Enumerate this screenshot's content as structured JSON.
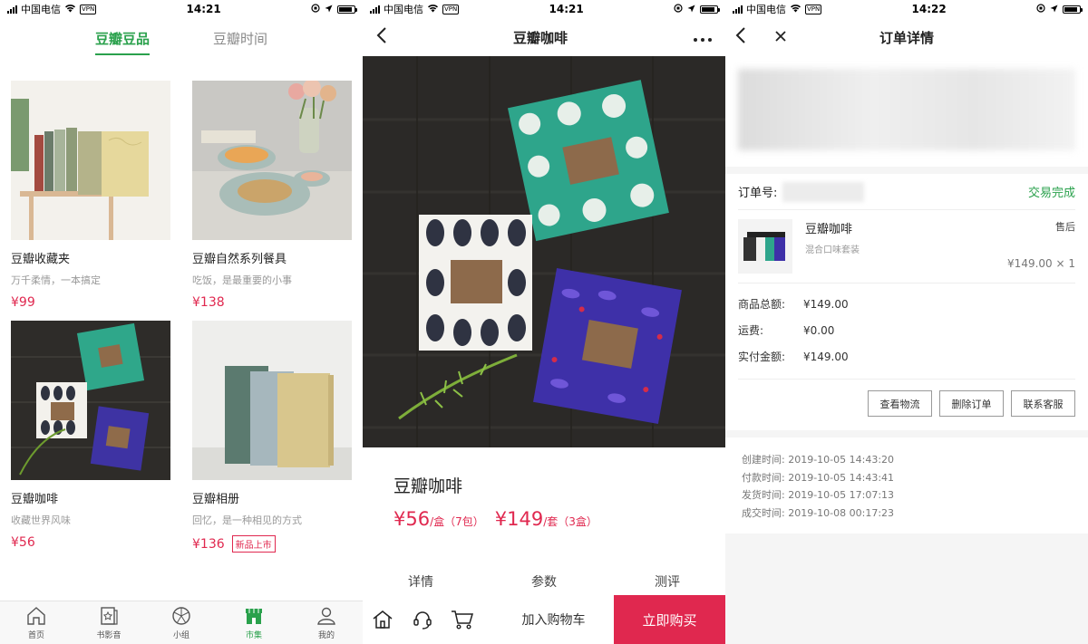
{
  "statusbar": [
    {
      "carrier": "中国电信",
      "vpn": "VPN",
      "time": "14:21"
    },
    {
      "carrier": "中国电信",
      "vpn": "VPN",
      "time": "14:21"
    },
    {
      "carrier": "中国电信",
      "vpn": "VPN",
      "time": "14:22"
    }
  ],
  "store": {
    "tabs": [
      "豆瓣豆品",
      "豆瓣时间"
    ],
    "products": [
      {
        "name": "豆瓣收藏夹",
        "desc": "万千柔情，一本搞定",
        "price": "¥99",
        "tag": ""
      },
      {
        "name": "豆瓣自然系列餐具",
        "desc": "吃饭，是最重要的小事",
        "price": "¥138",
        "tag": ""
      },
      {
        "name": "豆瓣咖啡",
        "desc": "收藏世界风味",
        "price": "¥56",
        "tag": ""
      },
      {
        "name": "豆瓣相册",
        "desc": "回忆，是一种相见的方式",
        "price": "¥136",
        "tag": "新品上市"
      }
    ],
    "tabbar": [
      {
        "label": "首页",
        "icon": "home-icon"
      },
      {
        "label": "书影音",
        "icon": "star-book-icon"
      },
      {
        "label": "小组",
        "icon": "group-icon"
      },
      {
        "label": "市集",
        "icon": "market-icon"
      },
      {
        "label": "我的",
        "icon": "profile-icon"
      }
    ]
  },
  "detail": {
    "title": "豆瓣咖啡",
    "product_title": "豆瓣咖啡",
    "price1": "¥56",
    "unit1": "/盒（7包）",
    "price2": "¥149",
    "unit2": "/套（3盒）",
    "tabs": [
      "详情",
      "参数",
      "测评"
    ],
    "add_cart": "加入购物车",
    "buy_now": "立即购买"
  },
  "order": {
    "title": "订单详情",
    "order_no_label": "订单号:",
    "status": "交易完成",
    "item_name": "豆瓣咖啡",
    "item_sub": "混合口味套装",
    "after_sale": "售后",
    "item_price": "¥149.00 × 1",
    "sums": [
      {
        "k": "商品总额:",
        "v": "¥149.00"
      },
      {
        "k": "运费:",
        "v": "¥0.00"
      },
      {
        "k": "实付金额:",
        "v": "¥149.00"
      }
    ],
    "actions": [
      "查看物流",
      "删除订单",
      "联系客服"
    ],
    "times": [
      "创建时间: 2019-10-05 14:43:20",
      "付款时间: 2019-10-05 14:43:41",
      "发货时间: 2019-10-05 17:07:13",
      "成交时间: 2019-10-08 00:17:23"
    ]
  }
}
